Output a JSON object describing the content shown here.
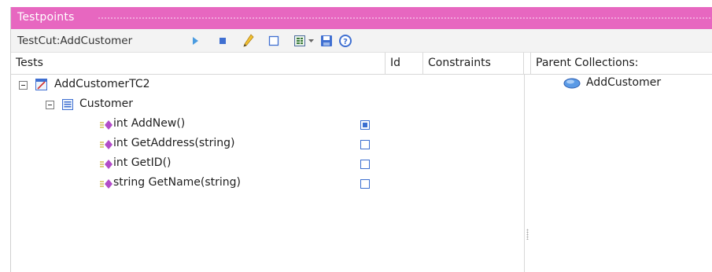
{
  "window": {
    "title": "Testpoints"
  },
  "toolbar": {
    "context_label": "TestCut:AddCustomer",
    "buttons": [
      {
        "name": "run-icon",
        "color": "#4a9be0"
      },
      {
        "name": "stop-icon",
        "color": "#3f6fd1"
      },
      {
        "name": "pencil-icon",
        "color": "#e8b21a"
      },
      {
        "name": "checkbox-icon",
        "color": "#3f6fd1"
      },
      {
        "name": "report-icon",
        "color": "#3a7a3a"
      },
      {
        "name": "dropdown-arrow-icon",
        "color": "#666666"
      },
      {
        "name": "save-icon",
        "color": "#3f6fd1"
      },
      {
        "name": "help-icon",
        "color": "#3f6fd1"
      }
    ]
  },
  "columns": {
    "tests": "Tests",
    "id": "Id",
    "constraints": "Constraints",
    "parent": "Parent Collections:"
  },
  "tree": {
    "testcase": {
      "label": "AddCustomerTC2",
      "expanded": true
    },
    "class": {
      "label": "Customer",
      "expanded": true
    },
    "methods": [
      {
        "label": "int AddNew()",
        "checked": true
      },
      {
        "label": "int GetAddress(string)",
        "checked": false
      },
      {
        "label": "int GetID()",
        "checked": false
      },
      {
        "label": "string GetName(string)",
        "checked": false
      }
    ]
  },
  "parent_collections": [
    {
      "label": "AddCustomer",
      "icon": "use-case-icon"
    }
  ],
  "colors": {
    "titlebar": "#e767c0",
    "accent": "#3b6fd0",
    "method_icon": "#b24cc9"
  }
}
